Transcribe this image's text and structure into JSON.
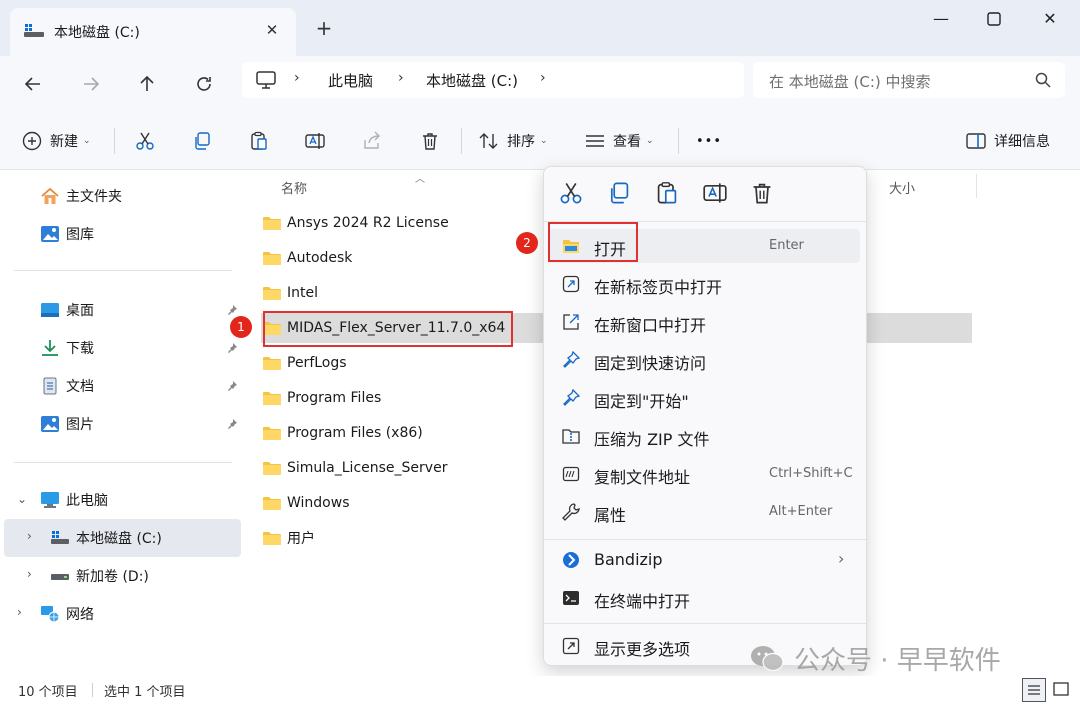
{
  "window": {
    "tab_title": "本地磁盘 (C:)",
    "tab_close": "✕",
    "new_tab": "+",
    "minimize": "—",
    "close": "✕"
  },
  "address": {
    "segments": [
      "此电脑",
      "本地磁盘 (C:)"
    ],
    "search_placeholder": "在 本地磁盘 (C:) 中搜索"
  },
  "toolbar": {
    "new_label": "新建",
    "sort_label": "排序",
    "view_label": "查看",
    "more_label": "•••",
    "details_label": "详细信息"
  },
  "sidebar": {
    "quick": [
      {
        "label": "主文件夹",
        "icon": "home-icon"
      },
      {
        "label": "图库",
        "icon": "gallery-icon"
      }
    ],
    "pinned": [
      {
        "label": "桌面",
        "icon": "desktop-icon"
      },
      {
        "label": "下载",
        "icon": "download-icon"
      },
      {
        "label": "文档",
        "icon": "document-icon"
      },
      {
        "label": "图片",
        "icon": "pictures-icon"
      }
    ],
    "tree": [
      {
        "label": "此电脑",
        "icon": "computer-icon"
      },
      {
        "label": "本地磁盘 (C:)",
        "icon": "drive-icon"
      },
      {
        "label": "新加卷 (D:)",
        "icon": "drive-icon"
      },
      {
        "label": "网络",
        "icon": "network-icon"
      }
    ]
  },
  "filelist": {
    "col_name": "名称",
    "col_size": "大小",
    "files": [
      "Ansys 2024 R2 License",
      "Autodesk",
      "Intel",
      "MIDAS_Flex_Server_11.7.0_x64",
      "PerfLogs",
      "Program Files",
      "Program Files (x86)",
      "Simula_License_Server",
      "Windows",
      "用户"
    ]
  },
  "annotations": {
    "badge1": "1",
    "badge2": "2"
  },
  "context_menu": {
    "items": [
      {
        "label": "打开",
        "key": "Enter",
        "icon": "folder-open-icon"
      },
      {
        "label": "在新标签页中打开",
        "key": "",
        "icon": "new-tab-icon"
      },
      {
        "label": "在新窗口中打开",
        "key": "",
        "icon": "new-window-icon"
      },
      {
        "label": "固定到快速访问",
        "key": "",
        "icon": "pin-icon"
      },
      {
        "label": "固定到\"开始\"",
        "key": "",
        "icon": "pin-start-icon"
      },
      {
        "label": "压缩为 ZIP 文件",
        "key": "",
        "icon": "zip-icon"
      },
      {
        "label": "复制文件地址",
        "key": "Ctrl+Shift+C",
        "icon": "copy-path-icon"
      },
      {
        "label": "属性",
        "key": "Alt+Enter",
        "icon": "wrench-icon"
      }
    ],
    "bandizip_label": "Bandizip",
    "terminal_label": "在终端中打开",
    "more_label": "显示更多选项"
  },
  "statusbar": {
    "count": "10 个项目",
    "selected": "选中 1 个项目"
  },
  "watermark": "公众号 · 早早软件",
  "colors": {
    "accent": "#0067c0",
    "folder": "#f5c342",
    "annotation_red": "#e03030"
  }
}
